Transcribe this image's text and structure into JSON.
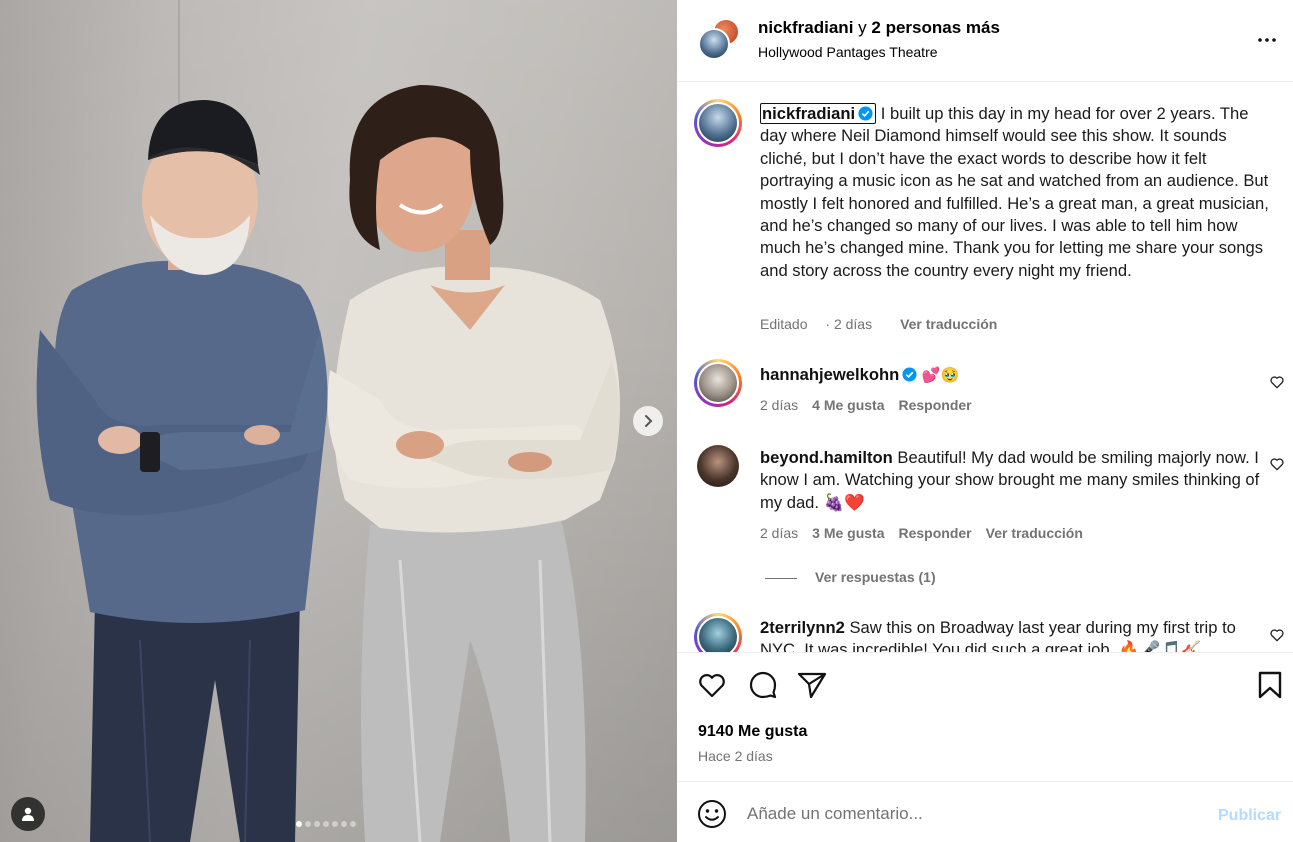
{
  "header": {
    "author": "nickfradiani",
    "connector": "y",
    "others": "2 personas más",
    "location": "Hollywood Pantages Theatre"
  },
  "caption": {
    "author": "nickfradiani",
    "text": "I built up this day in my head for over 2 years. The day where Neil Diamond himself would see this show. It sounds cliché, but I don’t have the exact words to describe how it felt portraying a music icon as he sat and watched from an audience. But mostly I felt honored and fulfilled. He’s a great man, a great musician, and he’s changed so many of our lives. I was able to tell him how much he’s changed mine. Thank you for letting me share your songs and story across the country every night my friend.",
    "edited": "Editado",
    "time": "2 días",
    "translate": "Ver traducción"
  },
  "comments": [
    {
      "user": "hannahjewelkohn",
      "text": "💕🥹",
      "time": "2 días",
      "likes": "4 Me gusta",
      "reply": "Responder"
    },
    {
      "user": "beyond.hamilton",
      "text": "Beautiful! My dad would be smiling majorly now. I know I am. Watching your show brought me many smiles thinking of my dad. 🍇❤️",
      "time": "2 días",
      "likes": "3 Me gusta",
      "reply": "Responder",
      "translate": "Ver traducción",
      "view_replies": "Ver respuestas (1)"
    },
    {
      "user": "2terrilynn2",
      "text": "Saw this on Broadway last year during my first trip to NYC. It was incredible! You did such a great job. 🔥🎤🎵🎸"
    }
  ],
  "stats": {
    "likes": "9140 Me gusta",
    "posted": "Hace 2 días"
  },
  "add_comment": {
    "placeholder": "Añade un comentario...",
    "publish": "Publicar"
  },
  "carousel": {
    "slide_count": 7,
    "active_index": 0
  },
  "icons": {
    "like": "heart-icon",
    "comment": "comment-bubble-icon",
    "share": "send-icon",
    "save": "bookmark-icon",
    "more": "more-horizontal-icon",
    "next": "chevron-right-icon",
    "tag": "user-tag-icon",
    "emoji": "emoji-icon"
  },
  "colors": {
    "verified": "#0095f6",
    "meta": "#737373",
    "publish_disabled": "#b3dbff"
  }
}
